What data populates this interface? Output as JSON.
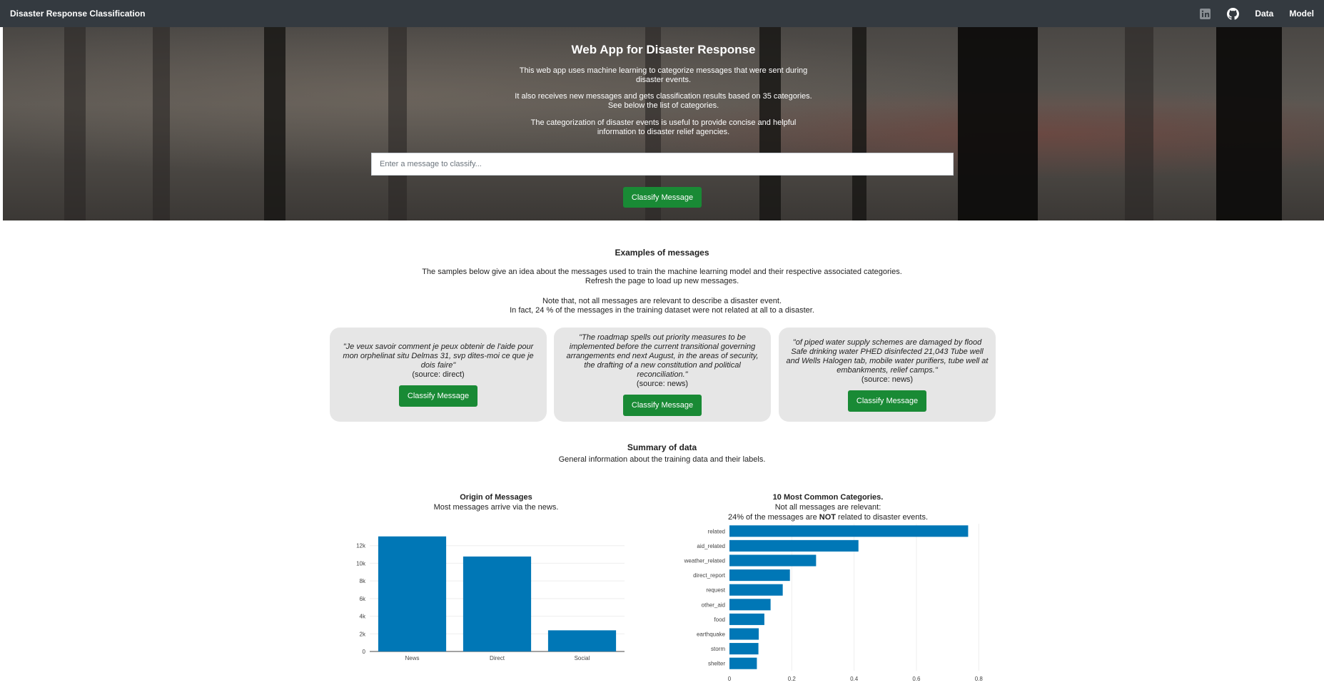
{
  "navbar": {
    "brand": "Disaster Response Classification",
    "links": [
      "Data",
      "Model"
    ],
    "icons": [
      "linkedin-icon",
      "github-icon"
    ]
  },
  "hero": {
    "title": "Web App for Disaster Response",
    "paragraphs": [
      [
        "This web app uses machine learning to categorize messages that were sent during",
        "disaster events."
      ],
      [
        "It also receives new messages and gets classification results based on 35 categories.",
        "See below the list of categories."
      ],
      [
        "The categorization of disaster events is useful to provide concise and helpful",
        "information to disaster relief agencies."
      ]
    ],
    "input_placeholder": "Enter a message to classify...",
    "button": "Classify Message"
  },
  "examples": {
    "title": "Examples of messages",
    "intro": [
      "The samples below give an idea about the messages used to train the machine learning model and their respective associated categories.",
      "Refresh the page to load up new messages."
    ],
    "note": [
      "Note that, not all messages are relevant to describe a disaster event.",
      "In fact, 24 % of the messages in the training dataset were not related at all to a disaster."
    ],
    "cards": [
      {
        "quote": "\"Je veux savoir comment je peux obtenir de l'aide pour mon orphelinat situ Delmas 31, svp dites-moi ce que je dois faire\"",
        "source": "(source: direct)",
        "button": "Classify Message"
      },
      {
        "quote": "\"The roadmap spells out priority measures to be implemented before the current transitional governing arrangements end next August, in the areas of security, the drafting of a new constitution and political reconciliation.\"",
        "source": "(source: news)",
        "button": "Classify Message"
      },
      {
        "quote": "\"of piped water supply schemes are damaged by flood Safe drinking water PHED disinfected 21,043 Tube well and Wells Halogen tab, mobile water purifiers, tube well at embankments, relief camps.\"",
        "source": "(source: news)",
        "button": "Classify Message"
      }
    ]
  },
  "summary": {
    "title": "Summary of data",
    "subtitle": "General information about the training data and their labels."
  },
  "colors": {
    "bar": "#0077b6",
    "button": "#198a35",
    "navbar": "#343a40"
  },
  "chart_data": [
    {
      "type": "bar",
      "title": "Origin of Messages",
      "subtitle": "Most messages arrive via the news.",
      "categories": [
        "News",
        "Direct",
        "Social"
      ],
      "values": [
        13050,
        10770,
        2400
      ],
      "ylim": [
        0,
        14000
      ],
      "yticks": [
        0,
        2000,
        4000,
        6000,
        8000,
        10000,
        12000
      ],
      "ytick_labels": [
        "0",
        "2k",
        "4k",
        "6k",
        "8k",
        "10k",
        "12k"
      ],
      "grid": true
    },
    {
      "type": "bar",
      "orientation": "horizontal",
      "title": "10 Most Common Categories.",
      "subtitle_lines": [
        "Not all messages are relevant:",
        "24% of the messages are ",
        "NOT",
        " related to disaster events."
      ],
      "categories": [
        "related",
        "aid_related",
        "weather_related",
        "direct_report",
        "request",
        "other_aid",
        "food",
        "earthquake",
        "storm",
        "shelter"
      ],
      "values": [
        0.766,
        0.414,
        0.278,
        0.194,
        0.171,
        0.132,
        0.112,
        0.094,
        0.093,
        0.088
      ],
      "xlim": [
        0,
        0.82
      ],
      "xticks": [
        0,
        0.2,
        0.4,
        0.6,
        0.8
      ],
      "xtick_labels": [
        "0",
        "0.2",
        "0.4",
        "0.6",
        "0.8"
      ],
      "grid": true
    }
  ]
}
